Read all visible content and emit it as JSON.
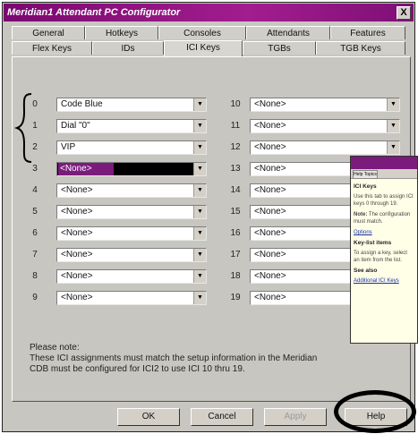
{
  "window": {
    "title": "Meridian1 Attendant PC Configurator",
    "close_glyph": "X"
  },
  "tabs_back": [
    "General",
    "Hotkeys",
    "Consoles",
    "Attendants",
    "Features"
  ],
  "tabs_front": [
    "Flex Keys",
    "IDs",
    "ICI Keys",
    "TGBs",
    "TGB Keys"
  ],
  "active_tab": "ICI Keys",
  "left_rows": [
    {
      "num": "0",
      "value": "Code Blue"
    },
    {
      "num": "1",
      "value": "Dial \"0\""
    },
    {
      "num": "2",
      "value": "VIP"
    },
    {
      "num": "3",
      "value": "<None>"
    },
    {
      "num": "4",
      "value": "<None>"
    },
    {
      "num": "5",
      "value": "<None>"
    },
    {
      "num": "6",
      "value": "<None>"
    },
    {
      "num": "7",
      "value": "<None>"
    },
    {
      "num": "8",
      "value": "<None>"
    },
    {
      "num": "9",
      "value": "<None>"
    }
  ],
  "right_rows": [
    {
      "num": "10",
      "value": "<None>"
    },
    {
      "num": "11",
      "value": "<None>"
    },
    {
      "num": "12",
      "value": "<None>"
    },
    {
      "num": "13",
      "value": "<None>"
    },
    {
      "num": "14",
      "value": "<None>"
    },
    {
      "num": "15",
      "value": "<None>"
    },
    {
      "num": "16",
      "value": "<None>"
    },
    {
      "num": "17",
      "value": "<None>"
    },
    {
      "num": "18",
      "value": "<None>"
    },
    {
      "num": "19",
      "value": "<None>"
    }
  ],
  "note": {
    "heading": "Please note:",
    "line1": "These ICI assignments must match the setup information in the Meridian",
    "line2": "CDB must be configured for ICI2 to use ICI 10 thru 19."
  },
  "buttons": {
    "ok": "OK",
    "cancel": "Cancel",
    "apply": "Apply",
    "help": "Help"
  },
  "help_window": {
    "tab": "Help Topics",
    "heading": "ICI Keys",
    "p1": "Use this tab to assign ICI keys 0 through 19.",
    "note_label": "Note:",
    "note_text": "The configuration must match.",
    "link1": "Options",
    "sub_heading": "Key-list items",
    "p2": "To assign a key, select an item from the list.",
    "see_also": "See also",
    "link2": "Additional ICI Keys"
  },
  "colors": {
    "title_bar": "#a21d8e",
    "selection": "#7b1c7d",
    "annotation": "#000000"
  },
  "icons": {
    "dropdown": "chevron-down-icon",
    "brace": "brace-annotation"
  }
}
